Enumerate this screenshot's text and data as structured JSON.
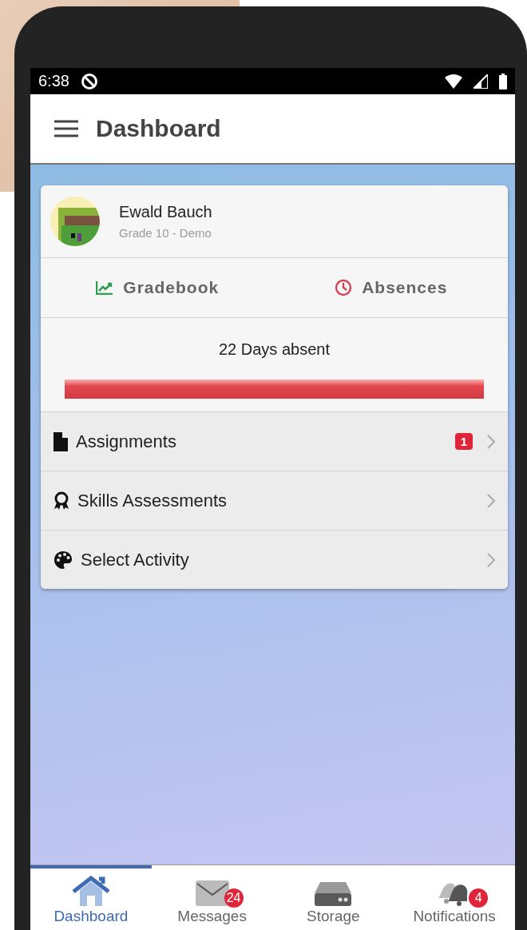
{
  "status_bar": {
    "time": "6:38"
  },
  "app_bar": {
    "title": "Dashboard"
  },
  "profile": {
    "name": "Ewald Bauch",
    "subtitle": "Grade 10 - Demo"
  },
  "quick_links": [
    {
      "kind": "gradebook",
      "label": "Gradebook",
      "color": "#2e9e4f"
    },
    {
      "kind": "absences",
      "label": "Absences",
      "color": "#d2404f"
    }
  ],
  "absence": {
    "text": "22 Days absent"
  },
  "menu_items": [
    {
      "kind": "file",
      "label": "Assignments",
      "badge": "1"
    },
    {
      "kind": "award",
      "label": "Skills Assessments"
    },
    {
      "kind": "palette",
      "label": "Select Activity"
    }
  ],
  "tabs": [
    {
      "kind": "home",
      "label": "Dashboard",
      "selected": true
    },
    {
      "kind": "mail",
      "label": "Messages",
      "badge": "24",
      "selected": false
    },
    {
      "kind": "storage",
      "label": "Storage",
      "selected": false
    },
    {
      "kind": "bell",
      "label": "Notifications",
      "badge": "4",
      "selected": false
    }
  ]
}
